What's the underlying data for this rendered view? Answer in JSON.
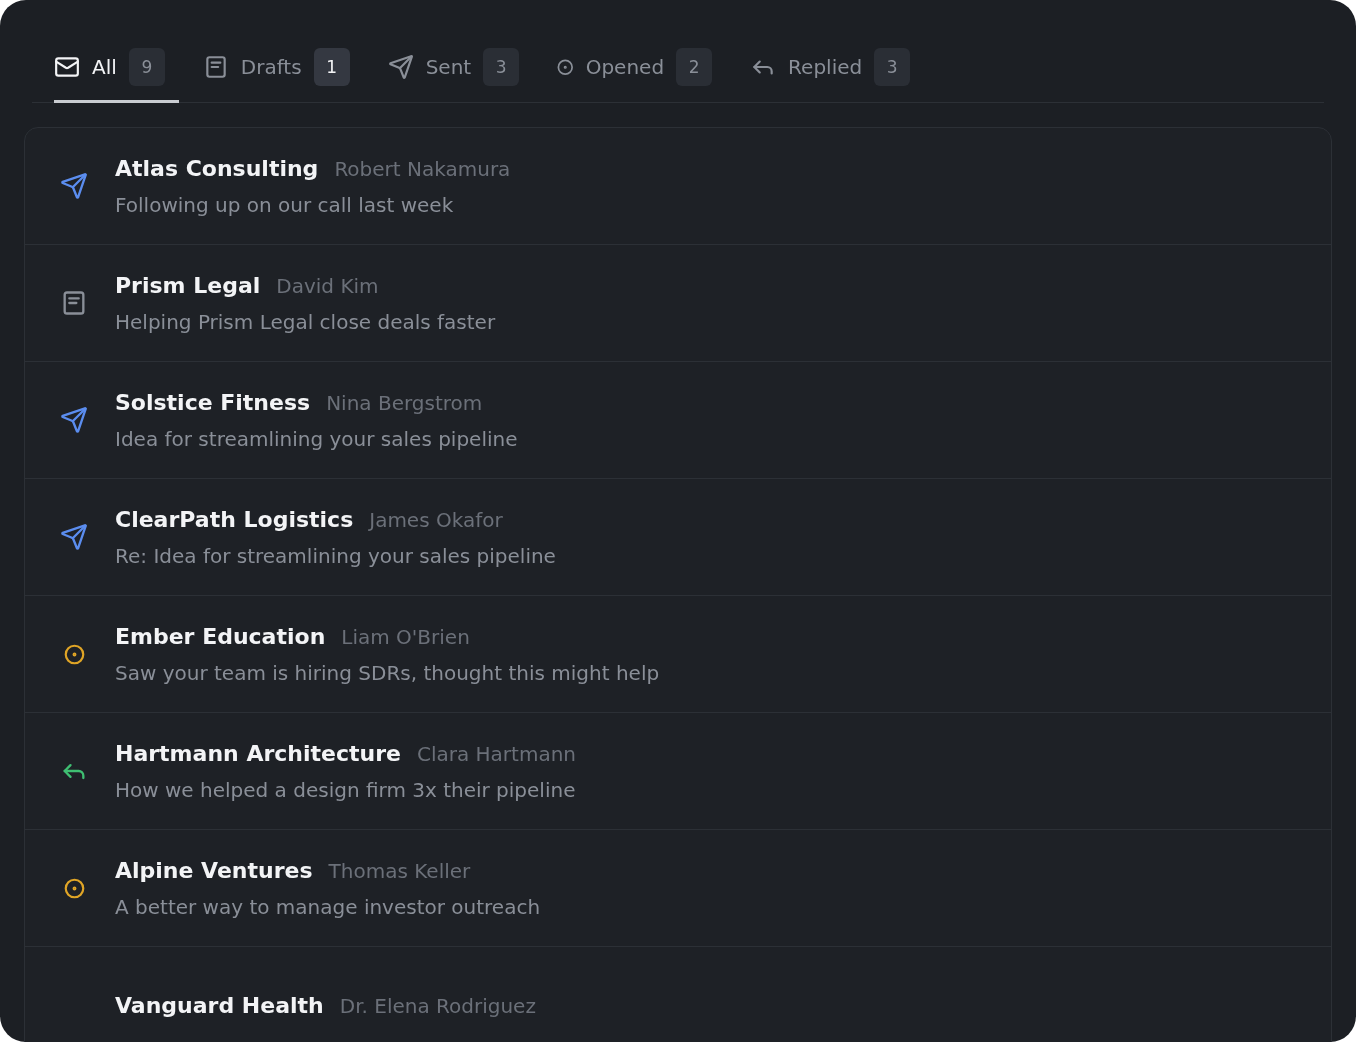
{
  "tabs": [
    {
      "label": "All",
      "kind": "all",
      "count": "9",
      "selected": true,
      "highlight": false
    },
    {
      "label": "Drafts",
      "kind": "draft",
      "count": "1",
      "selected": false,
      "highlight": true
    },
    {
      "label": "Sent",
      "kind": "sent",
      "count": "3",
      "selected": false,
      "highlight": false
    },
    {
      "label": "Opened",
      "kind": "opened",
      "count": "2",
      "selected": false,
      "highlight": false
    },
    {
      "label": "Replied",
      "kind": "replied",
      "count": "3",
      "selected": false,
      "highlight": false
    }
  ],
  "emails": [
    {
      "kind": "sent",
      "company": "Atlas Consulting",
      "contact": "Robert Nakamura",
      "subject": "Following up on our call last week"
    },
    {
      "kind": "draft",
      "company": "Prism Legal",
      "contact": "David Kim",
      "subject": "Helping Prism Legal close deals faster"
    },
    {
      "kind": "sent",
      "company": "Solstice Fitness",
      "contact": "Nina Bergstrom",
      "subject": "Idea for streamlining your sales pipeline"
    },
    {
      "kind": "sent",
      "company": "ClearPath Logistics",
      "contact": "James Okafor",
      "subject": "Re: Idea for streamlining your sales pipeline"
    },
    {
      "kind": "opened",
      "company": "Ember Education",
      "contact": "Liam O'Brien",
      "subject": "Saw your team is hiring SDRs, thought this might help"
    },
    {
      "kind": "replied",
      "company": "Hartmann Architecture",
      "contact": "Clara Hartmann",
      "subject": "How we helped a design firm 3x their pipeline"
    },
    {
      "kind": "opened",
      "company": "Alpine Ventures",
      "contact": "Thomas Keller",
      "subject": "A better way to manage investor outreach"
    },
    {
      "company": "Vanguard Health",
      "contact": "Dr. Elena Rodriguez"
    }
  ]
}
